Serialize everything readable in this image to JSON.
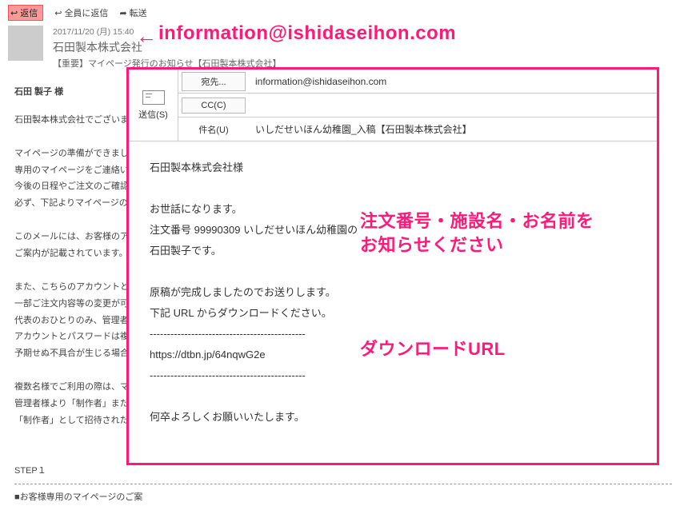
{
  "toolbar": {
    "reply": "返信",
    "replyAll": "全員に返信",
    "forward": "転送"
  },
  "header": {
    "date": "2017/11/20 (月) 15:40",
    "from": "石田製本株式会社",
    "subject": "【重要】マイページ発行のお知らせ【石田製本株式会社】"
  },
  "msg": {
    "greet": "石田 製子 様",
    "l1": "石田製本株式会社でございます。",
    "l2": "マイページの準備ができましたので",
    "l3": "専用のマイページをご連絡いたしま",
    "l4": "今後の日程やご注文のご確認、校正",
    "l5": "必ず、下記よりマイページの登録を",
    "l6": "このメールには、お客様のアカウン",
    "l7": "ご案内が記載されています。大切に",
    "l8": "また、こちらのアカウントとパスワ",
    "l9": "一部ご注文内容等の変更が可能で",
    "l10": "代表のおひとりのみ、管理者として",
    "l11": "アカウントとパスワードは複数名で",
    "l12": "予期せぬ不具合が生じる場合がご",
    "l13": "複数名様でご利用の際は、マイペー",
    "l14": "管理者様より「制作者」または「閲",
    "l15": "「制作者」として招待された担当",
    "step": "STEP１",
    "l16": "■お客様専用のマイページのご案"
  },
  "compose": {
    "send": "送信(S)",
    "toLabel": "宛先...",
    "to": "information@ishidaseihon.com",
    "ccLabel": "CC(C)",
    "cc": "",
    "subjLabel": "件名(U)",
    "subj": "いしだせいほん幼稚園_入稿【石田製本株式会社】",
    "b1": "石田製本株式会社様",
    "b2": "お世話になります。",
    "b3": "注文番号 99990309 いしだせいほん幼稚園の",
    "b4": "石田製子です。",
    "b5": "原稿が完成しましたのでお送りします。",
    "b6": "下記 URL からダウンロードください。",
    "dash": "---------------------------------------------",
    "url": "https://dtbn.jp/64nqwG2e",
    "b7": "何卒よろしくお願いいたします。"
  },
  "ann": {
    "email": "information@ishidaseihon.com",
    "note1a": "注文番号・施設名・お名前を",
    "note1b": "お知らせください",
    "note2": "ダウンロードURL"
  }
}
